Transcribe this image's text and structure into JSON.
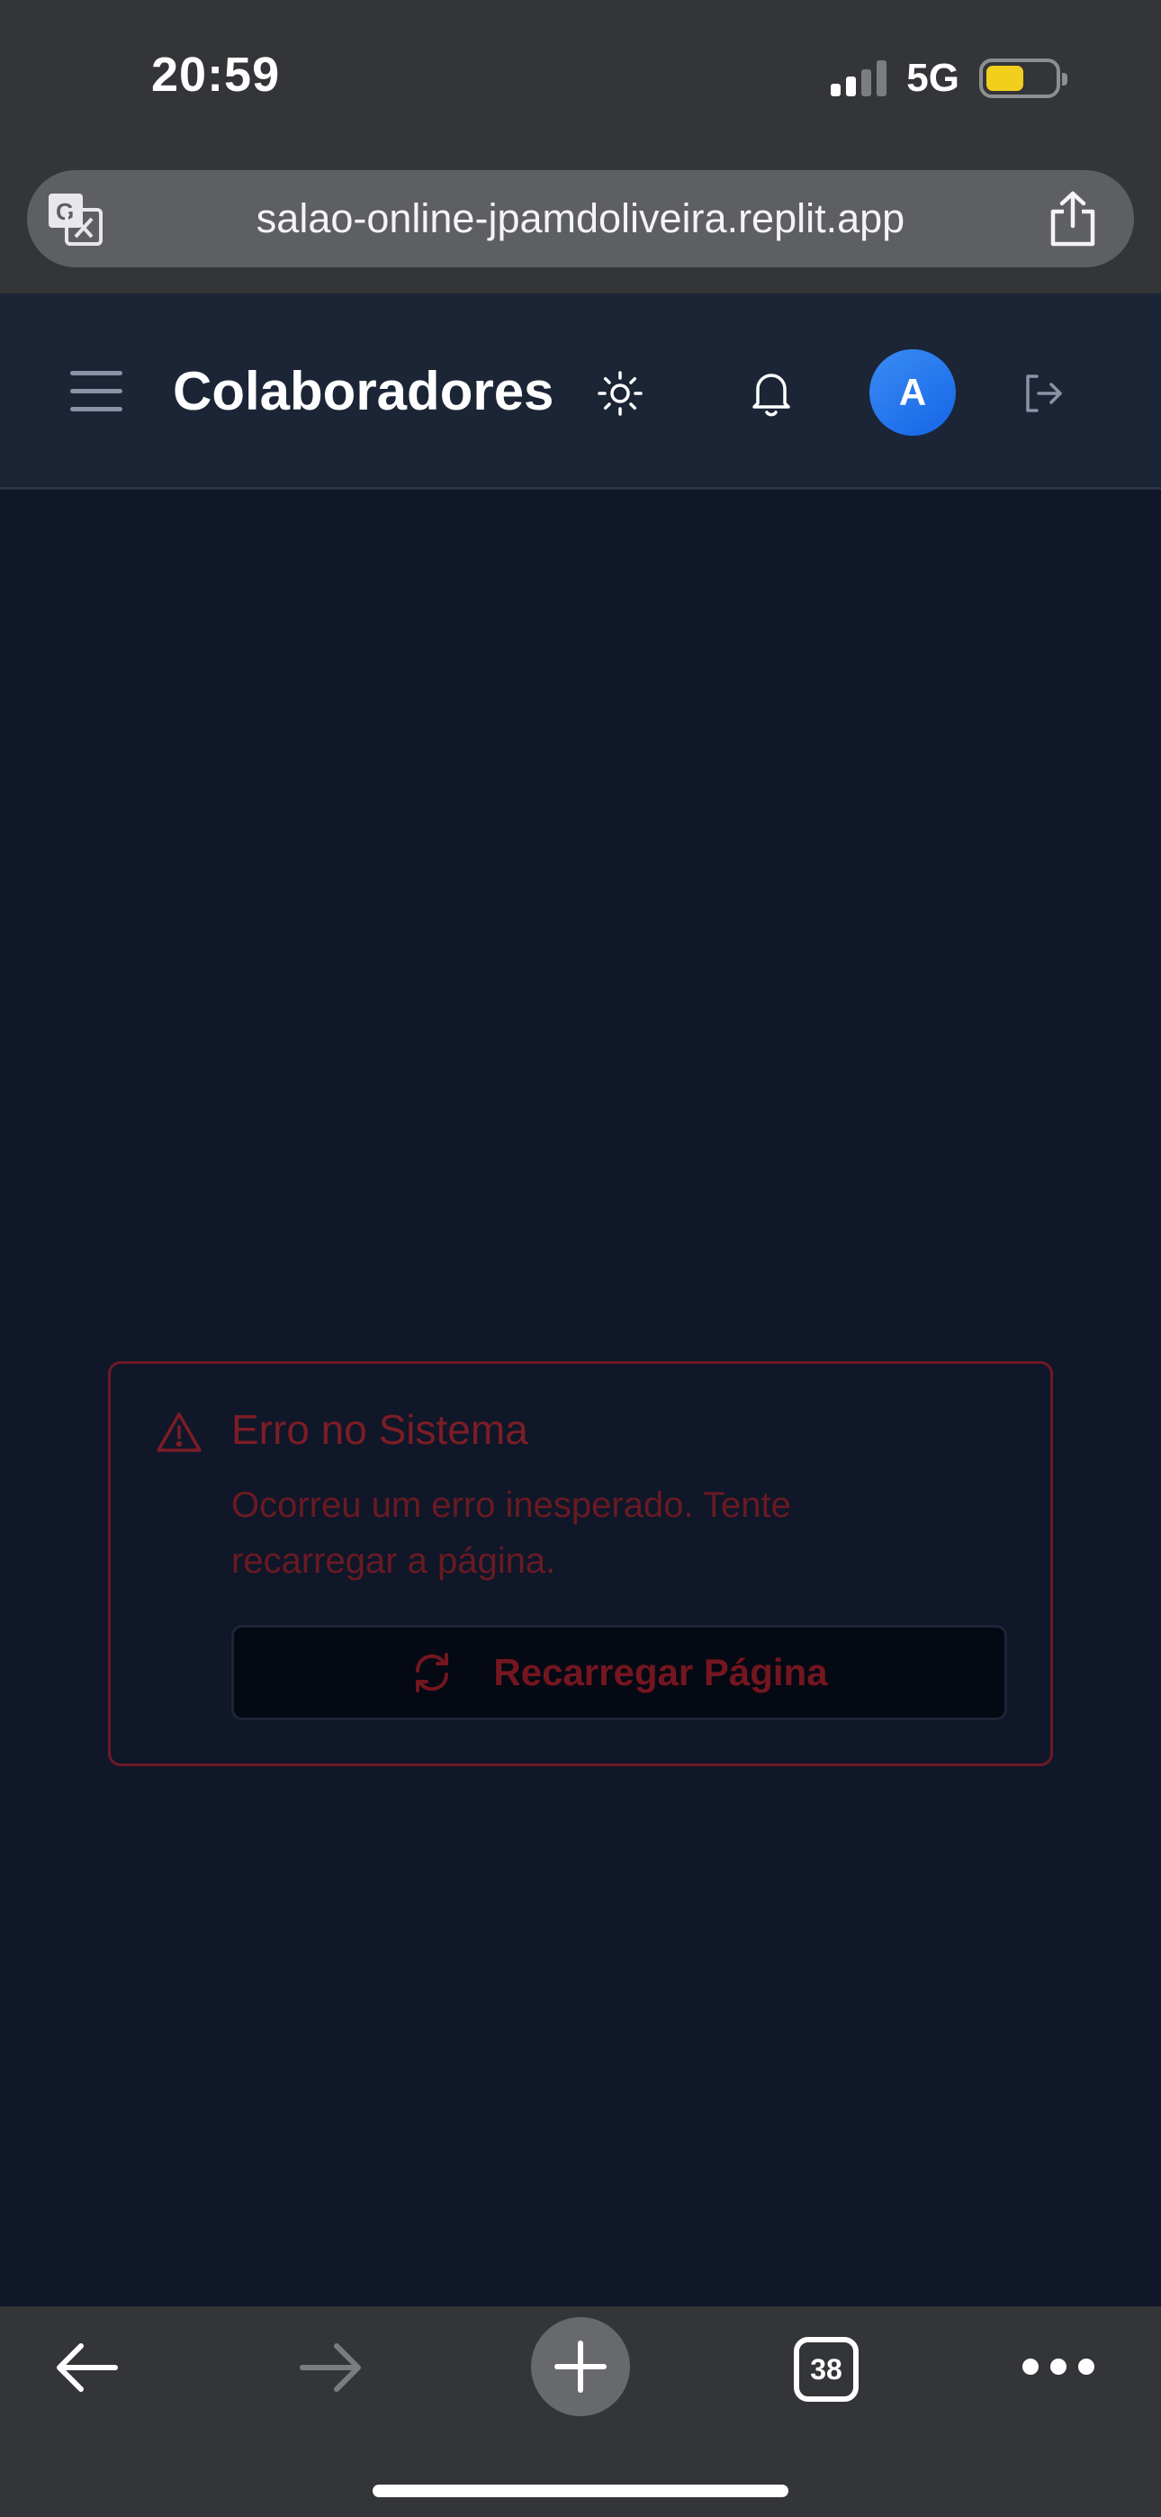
{
  "status_bar": {
    "time": "20:59",
    "network": "5G",
    "battery_level": 0.56,
    "battery_color": "#f2cf1d"
  },
  "browser": {
    "url": "salao-online-jpamdoliveira.replit.app",
    "tab_count": "38",
    "icons": {
      "translate": "translate-icon",
      "share": "share-icon",
      "back": "arrow-left-icon",
      "forward": "arrow-right-icon",
      "new_tab": "plus-icon",
      "tabs": "tabs-icon",
      "more": "more-icon"
    }
  },
  "header": {
    "title": "Colaboradores",
    "avatar_initial": "A",
    "icons": {
      "menu": "hamburger-icon",
      "theme": "sun-icon",
      "notifications": "bell-icon",
      "logout": "logout-icon"
    }
  },
  "error": {
    "title": "Erro no Sistema",
    "message": "Ocorreu um erro inesperado. Tente recarregar a página.",
    "reload_label": "Recarregar Página",
    "accent_color": "#7c1d25"
  }
}
